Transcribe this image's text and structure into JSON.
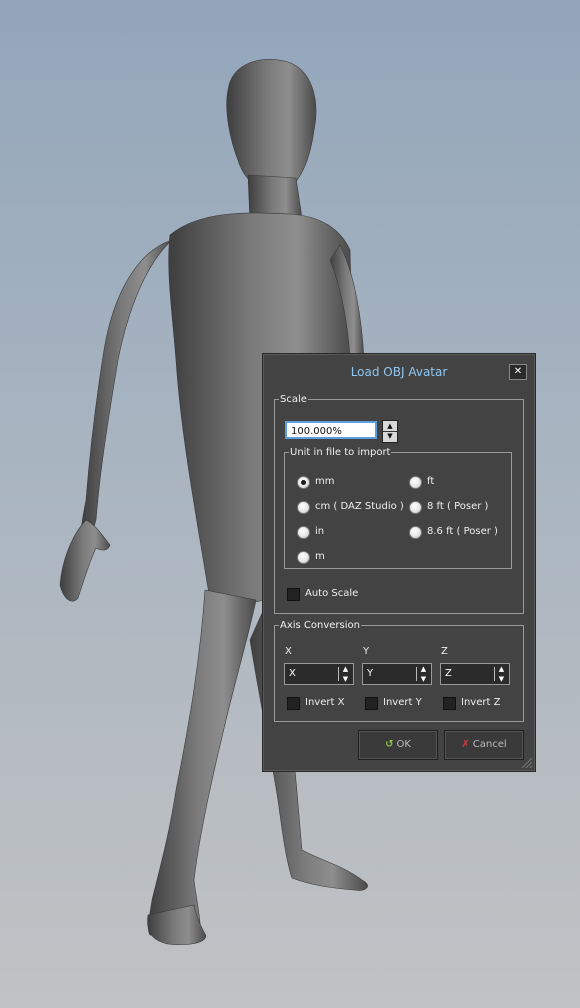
{
  "dialog": {
    "title": "Load OBJ Avatar",
    "close_symbol": "✕",
    "scale": {
      "legend": "Scale",
      "value": "100.000%",
      "unit_legend": "Unit in file to import",
      "units": [
        {
          "label": "mm",
          "selected": true
        },
        {
          "label": "cm ( DAZ Studio )",
          "selected": false
        },
        {
          "label": "in",
          "selected": false
        },
        {
          "label": "m",
          "selected": false
        },
        {
          "label": "ft",
          "selected": false
        },
        {
          "label": "8 ft ( Poser )",
          "selected": false
        },
        {
          "label": "8.6 ft ( Poser )",
          "selected": false
        }
      ],
      "auto_scale": "Auto Scale"
    },
    "axis": {
      "legend": "Axis Conversion",
      "columns": [
        {
          "header": "X",
          "value": "X",
          "invert": "Invert X"
        },
        {
          "header": "Y",
          "value": "Y",
          "invert": "Invert Y"
        },
        {
          "header": "Z",
          "value": "Z",
          "invert": "Invert Z"
        }
      ]
    },
    "buttons": {
      "ok": "OK",
      "cancel": "Cancel"
    }
  },
  "colors": {
    "title": "#8fc6f2",
    "dialog_bg": "#434343",
    "accent_focus": "#5b9fdf"
  }
}
